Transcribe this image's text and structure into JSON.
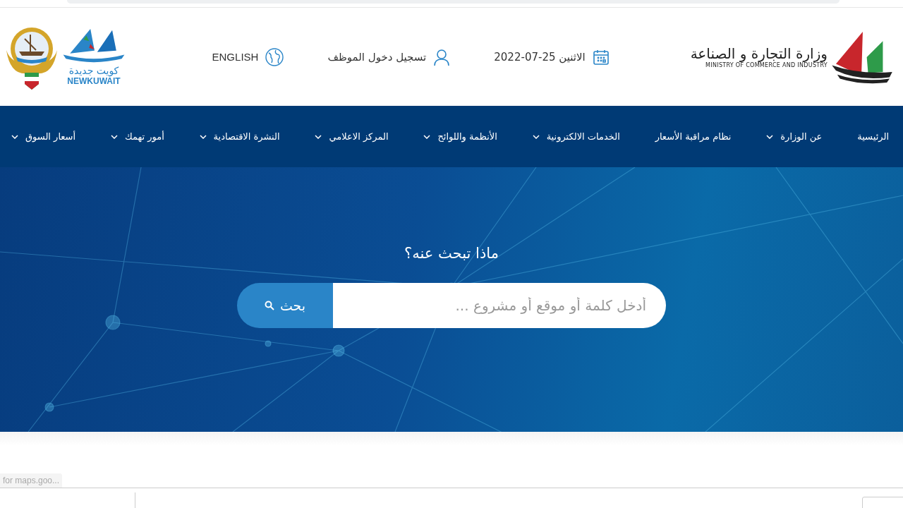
{
  "header": {
    "ministry_logo": {
      "name_ar": "وزارة التجارة و الصناعة",
      "name_en": "MINISTRY OF COMMERCE AND INDUSTRY"
    },
    "date": "الاثنين 25-07-2022",
    "login": "تسجيل دخول الموظف",
    "language": "ENGLISH",
    "new_kuwait_logo": {
      "name_ar": "كويت جديدة",
      "name_en": "NEWKUWAIT"
    }
  },
  "nav": [
    {
      "label": "الرئيسية",
      "has_dropdown": false
    },
    {
      "label": "عن الوزارة",
      "has_dropdown": true
    },
    {
      "label": "نظام مراقبة الأسعار",
      "has_dropdown": false
    },
    {
      "label": "الخدمات الالكترونية",
      "has_dropdown": true
    },
    {
      "label": "الأنظمة واللوائح",
      "has_dropdown": true
    },
    {
      "label": "المركز الاعلامي",
      "has_dropdown": true
    },
    {
      "label": "النشرة الاقتصادية",
      "has_dropdown": true
    },
    {
      "label": "أمور تهمك",
      "has_dropdown": true
    },
    {
      "label": "أسعار السوق",
      "has_dropdown": true
    }
  ],
  "hero": {
    "heading": "ماذا تبحث عنه؟",
    "search": {
      "placeholder": "أدخل كلمة أو موقع أو مشروع ...",
      "button": "بحث"
    }
  },
  "status_bar": {
    "text": "for maps.goo..."
  }
}
